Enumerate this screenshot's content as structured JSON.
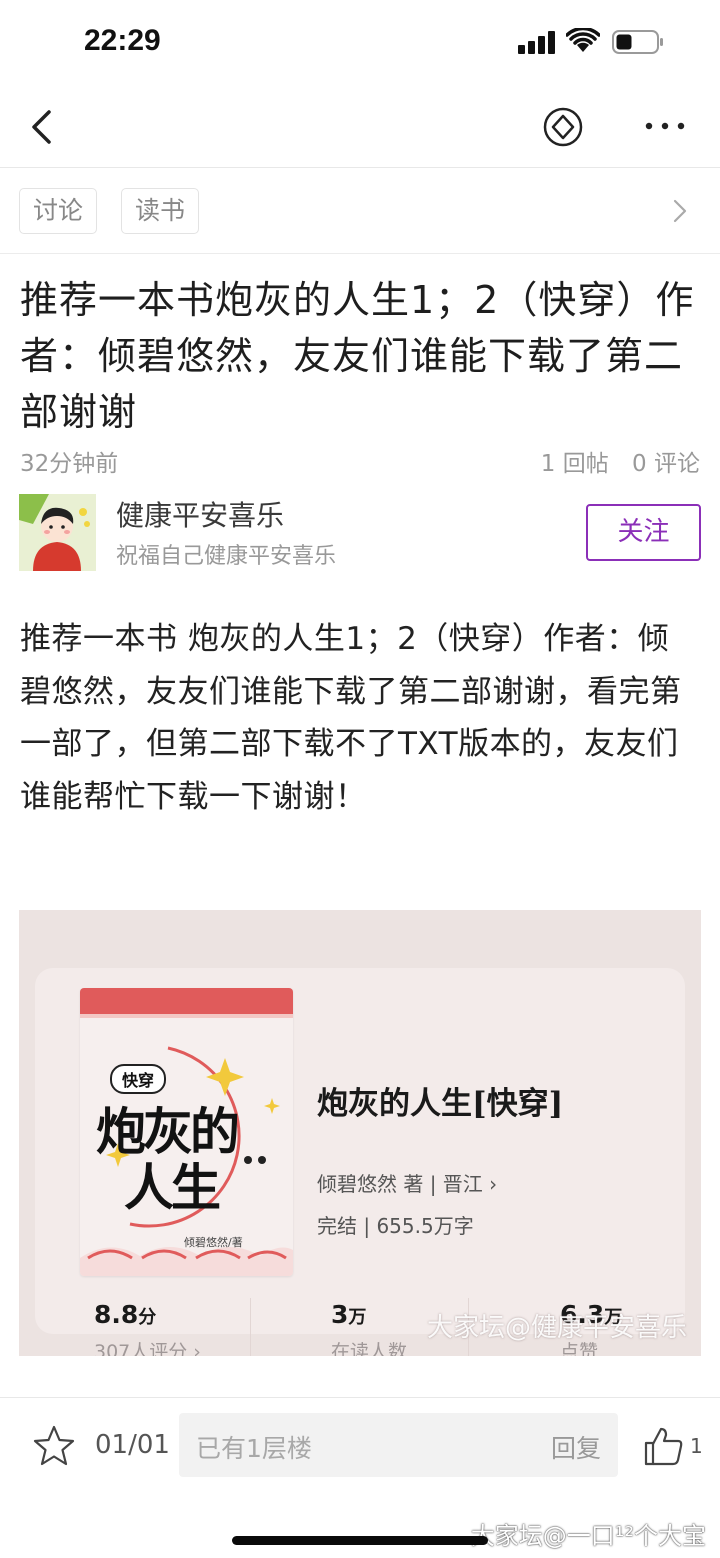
{
  "status_bar": {
    "time": "22:29",
    "signal_icon": "cellular-signal-icon",
    "wifi_icon": "wifi-icon",
    "battery_icon": "battery-icon"
  },
  "nav": {
    "back_icon": "chevron-left-icon",
    "diamond_icon": "diamond-badge-icon",
    "more_icon": "more-dots-icon"
  },
  "tags": [
    "讨论",
    "读书"
  ],
  "post": {
    "title": "推荐一本书炮灰的人生1；2（快穿）作者：倾碧悠然，友友们谁能下载了第二部谢谢",
    "time": "32分钟前",
    "replies": "1 回帖",
    "comments": "0 评论",
    "author": {
      "name": "健康平安喜乐",
      "signature": "祝福自己健康平安喜乐",
      "follow_label": "关注"
    },
    "body": "推荐一本书  炮灰的人生1；2（快穿）作者：倾碧悠然，友友们谁能下载了第二部谢谢，看完第一部了，但第二部下载不了TXT版本的，友友们谁能帮忙下载一下谢谢！"
  },
  "book_card": {
    "cover_tag": "快穿",
    "cover_title_line1": "炮灰的",
    "cover_title_line2": "人生",
    "cover_author": "倾碧悠然/著",
    "title": "炮灰的人生[快穿]",
    "author_line": "倾碧悠然 著 | 晋江 ›",
    "status_line": "完结 | 655.5万字",
    "stats": [
      {
        "value": "8.8",
        "unit": "分",
        "label": "307人评分 ›"
      },
      {
        "value": "3",
        "unit": "万",
        "label": "在读人数"
      },
      {
        "value": "6.3",
        "unit": "万",
        "label": "点赞"
      }
    ],
    "watermark": "大家坛@健康平安喜乐"
  },
  "bottom_bar": {
    "star_icon": "star-outline-icon",
    "page": "01/01",
    "reply_placeholder": "已有1层楼",
    "reply_label": "回复",
    "like_icon": "thumbs-up-icon",
    "like_count": "1",
    "watermark": "大家坛@一口¹²个大宝"
  },
  "colors": {
    "accent": "#8b2fb8",
    "cover_red": "#e05b5b"
  }
}
